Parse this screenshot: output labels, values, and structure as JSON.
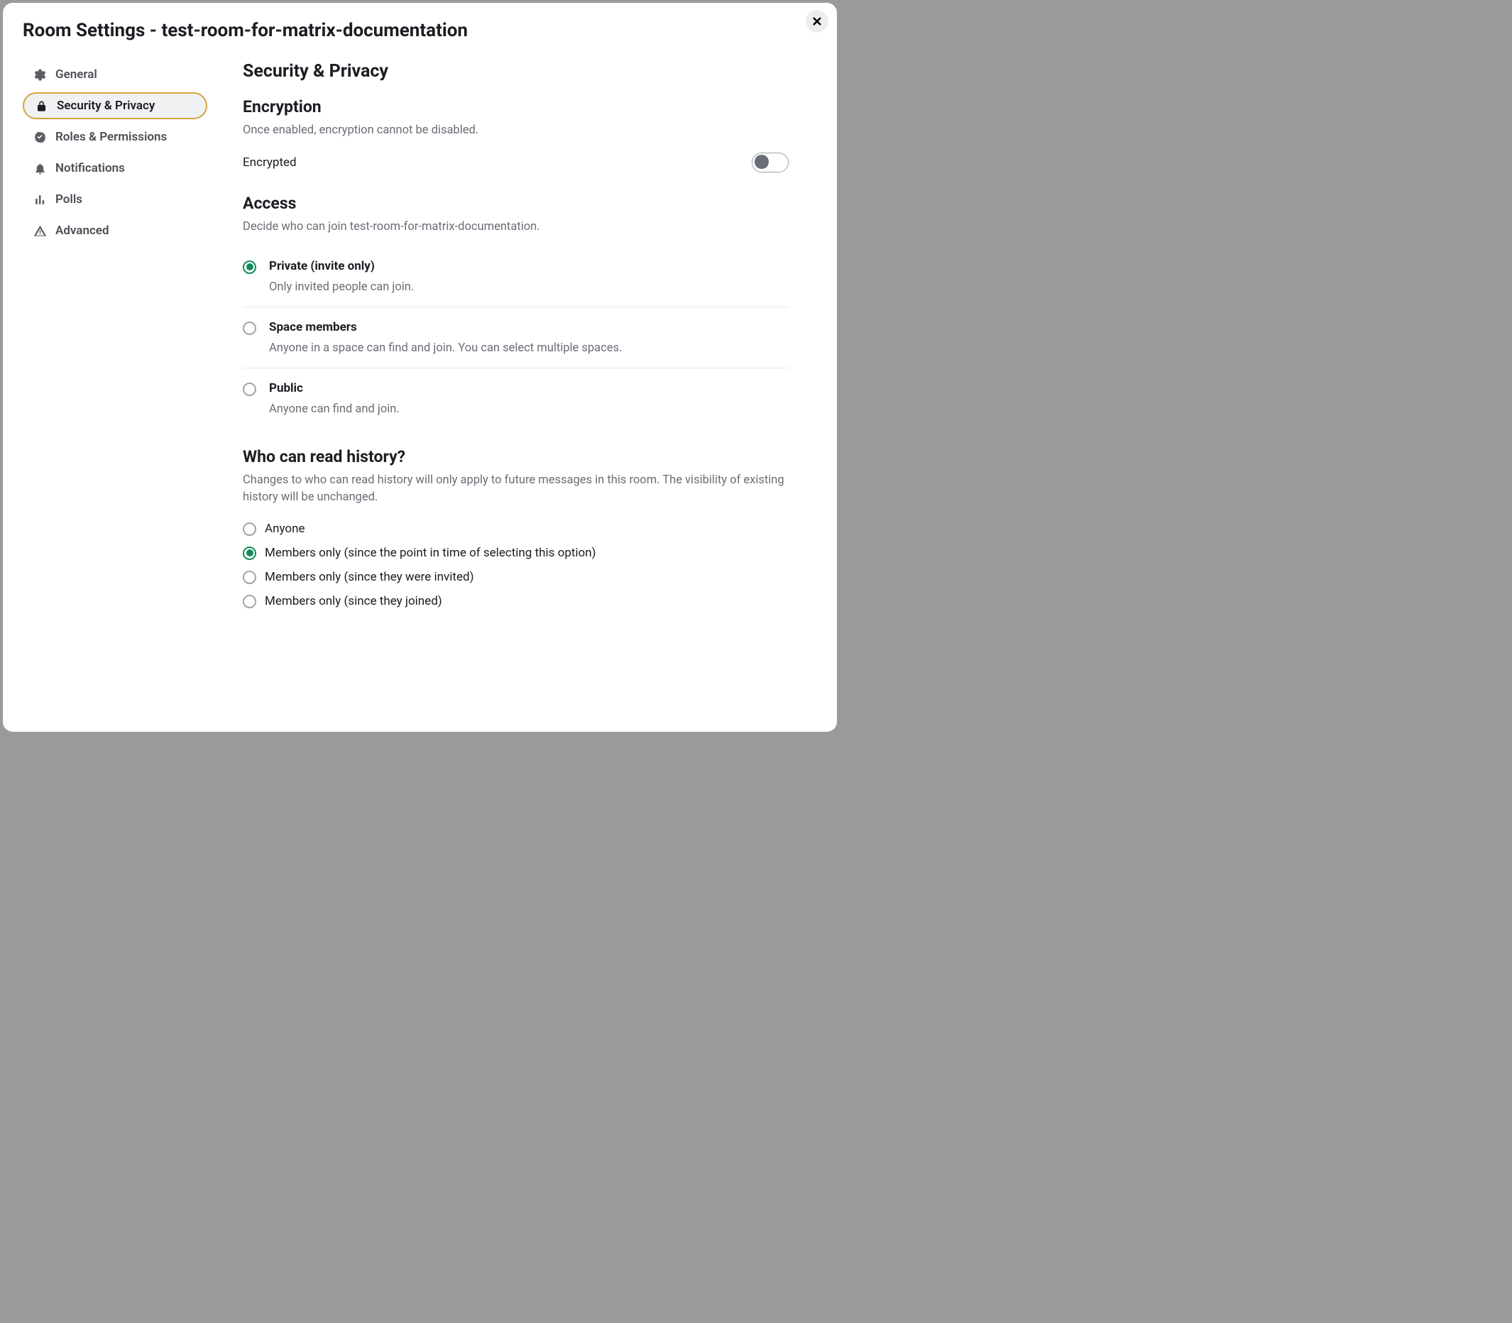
{
  "dialog": {
    "title": "Room Settings - test-room-for-matrix-documentation",
    "close_label": "Close"
  },
  "sidebar": {
    "items": [
      {
        "id": "general",
        "label": "General"
      },
      {
        "id": "security",
        "label": "Security & Privacy"
      },
      {
        "id": "roles",
        "label": "Roles & Permissions"
      },
      {
        "id": "notifications",
        "label": "Notifications"
      },
      {
        "id": "polls",
        "label": "Polls"
      },
      {
        "id": "advanced",
        "label": "Advanced"
      }
    ]
  },
  "panel": {
    "heading": "Security & Privacy",
    "encryption": {
      "heading": "Encryption",
      "description": "Once enabled, encryption cannot be disabled.",
      "toggle_label": "Encrypted",
      "enabled": false
    },
    "access": {
      "heading": "Access",
      "description": "Decide who can join test-room-for-matrix-documentation.",
      "options": [
        {
          "id": "private",
          "title": "Private (invite only)",
          "description": "Only invited people can join.",
          "selected": true
        },
        {
          "id": "space",
          "title": "Space members",
          "description": "Anyone in a space can find and join. You can select multiple spaces.",
          "selected": false
        },
        {
          "id": "public",
          "title": "Public",
          "description": "Anyone can find and join.",
          "selected": false
        }
      ]
    },
    "history": {
      "heading": "Who can read history?",
      "description": "Changes to who can read history will only apply to future messages in this room. The visibility of existing history will be unchanged.",
      "options": [
        {
          "id": "anyone",
          "label": "Anyone",
          "selected": false
        },
        {
          "id": "members-since-select",
          "label": "Members only (since the point in time of selecting this option)",
          "selected": true
        },
        {
          "id": "members-since-invited",
          "label": "Members only (since they were invited)",
          "selected": false
        },
        {
          "id": "members-since-joined",
          "label": "Members only (since they joined)",
          "selected": false
        }
      ]
    }
  }
}
